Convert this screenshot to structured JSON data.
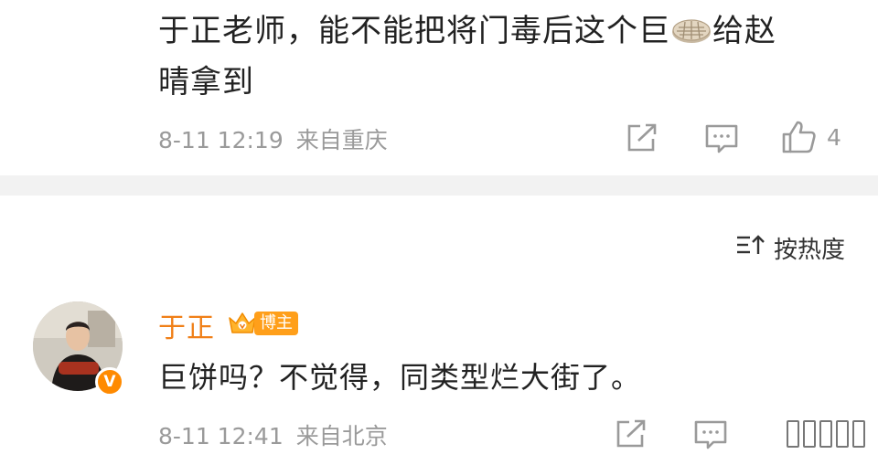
{
  "comment1": {
    "text_line1_a": "于正老师，能不能把将门毒后这个巨",
    "text_line1_b": "给赵",
    "text_line2": "晴拿到",
    "emoji": "pancake-emoji",
    "time": "8-11 12:19",
    "location": "来自重庆",
    "like_count": "4"
  },
  "sort": {
    "label": "按热度"
  },
  "comment2": {
    "username": "于正",
    "badge": "博主",
    "verified_mark": "V",
    "text": "巨饼吗？不觉得，同类型烂大街了。",
    "time": "8-11 12:41",
    "location": "来自北京"
  },
  "colors": {
    "username": "#f07f17",
    "meta": "#9a9a9a",
    "divider": "#f2f2f2"
  }
}
